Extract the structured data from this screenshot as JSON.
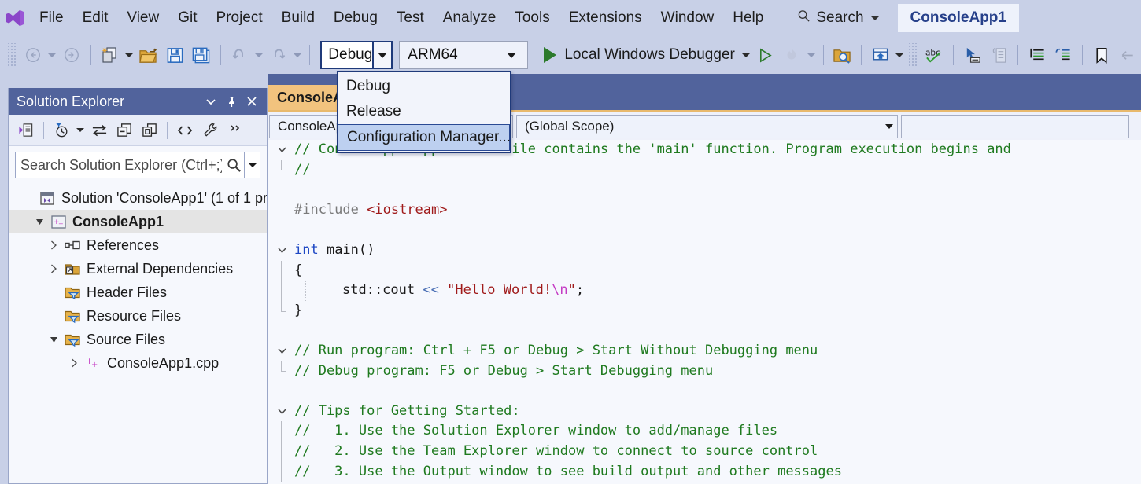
{
  "menubar": {
    "logo_icon": "visual-studio-logo",
    "items": [
      "File",
      "Edit",
      "View",
      "Git",
      "Project",
      "Build",
      "Debug",
      "Test",
      "Analyze",
      "Tools",
      "Extensions",
      "Window",
      "Help"
    ],
    "search": {
      "label": "Search",
      "icon": "search-icon",
      "caret_icon": "chevron-down-icon"
    },
    "project_chip": "ConsoleApp1"
  },
  "toolbar": {
    "nav_back": "back-icon",
    "nav_forward": "forward-icon",
    "new_item": "new-item-icon",
    "open_file": "open-file-icon",
    "save": "save-icon",
    "save_all": "save-all-icon",
    "undo": "undo-icon",
    "redo": "redo-icon",
    "configuration": {
      "value": "Debug",
      "caret_icon": "chevron-down-icon"
    },
    "platform": {
      "value": "ARM64",
      "caret_icon": "chevron-down-icon"
    },
    "run": {
      "label": "Local Windows Debugger",
      "play_icon": "play-icon",
      "caret_icon": "chevron-down-icon"
    },
    "start_no_debug_icon": "play-outline-icon",
    "hot_reload_icon": "hot-reload-flame-icon",
    "right_icons": [
      "folder-search-icon",
      "window-layout-icon",
      "spell-check-abc-icon",
      "select-tool-icon",
      "indent-block-icon",
      "comment-lines-icon",
      "uncomment-lines-icon",
      "bookmark-icon",
      "previous-bookmark-icon"
    ]
  },
  "configuration_menu": {
    "open": true,
    "items": [
      {
        "label": "Debug",
        "selected": false
      },
      {
        "label": "Release",
        "selected": false
      },
      {
        "label": "Configuration Manager...",
        "selected": true
      }
    ]
  },
  "solution_explorer": {
    "title": "Solution Explorer",
    "title_buttons": [
      "chevron-down-icon",
      "pin-icon",
      "close-icon"
    ],
    "toolbar_icons": [
      "home-solution-icon",
      "pending-changes-filter-icon",
      "sync-with-active-document-icon",
      "collapse-all-icon",
      "show-all-files-icon",
      "view-code-icon",
      "properties-wrench-icon",
      "overflow-chevrons-icon"
    ],
    "search_placeholder": "Search Solution Explorer (Ctrl+;)",
    "search_value": "",
    "search_icon": "magnifier-icon",
    "search_dropdown_icon": "chevron-down-icon",
    "tree": [
      {
        "label": "Solution 'ConsoleApp1' (1 of 1 pr",
        "icon": "solution-icon",
        "indent": 0,
        "expander": "none",
        "bold": false,
        "selected": false
      },
      {
        "label": "ConsoleApp1",
        "icon": "cpp-project-icon",
        "indent": 1,
        "expander": "expanded",
        "bold": true,
        "selected": true
      },
      {
        "label": "References",
        "icon": "references-icon",
        "indent": 2,
        "expander": "collapsed",
        "bold": false,
        "selected": false
      },
      {
        "label": "External Dependencies",
        "icon": "external-dependencies-icon",
        "indent": 2,
        "expander": "collapsed",
        "bold": false,
        "selected": false
      },
      {
        "label": "Header Files",
        "icon": "filter-folder-icon",
        "indent": 2,
        "expander": "none",
        "bold": false,
        "selected": false
      },
      {
        "label": "Resource Files",
        "icon": "filter-folder-icon",
        "indent": 2,
        "expander": "none",
        "bold": false,
        "selected": false
      },
      {
        "label": "Source Files",
        "icon": "filter-folder-icon",
        "indent": 2,
        "expander": "expanded",
        "bold": false,
        "selected": false
      },
      {
        "label": "ConsoleApp1.cpp",
        "icon": "cpp-file-icon",
        "indent": 3,
        "expander": "collapsed",
        "bold": false,
        "selected": false
      }
    ]
  },
  "editor": {
    "tab": {
      "label": "ConsoleApp1.cpp",
      "active": true,
      "close_icon": "close-icon"
    },
    "navbar": {
      "project": {
        "value": "ConsoleApp1",
        "caret_icon": "chevron-down-icon"
      },
      "scope": {
        "value": "(Global Scope)",
        "caret_icon": "chevron-down-icon"
      },
      "member": {
        "value": "",
        "caret_icon": "chevron-down-icon"
      }
    },
    "code": [
      {
        "fold": "down",
        "guide": "top",
        "segments": [
          {
            "t": "// ConsoleApp1.cpp : This file contains the 'main' function. Program execution begins and",
            "c": "cm"
          }
        ]
      },
      {
        "fold": "none",
        "guide": "end",
        "segments": [
          {
            "t": "//",
            "c": "cm"
          }
        ]
      },
      {
        "fold": "none",
        "guide": "none",
        "segments": [
          {
            "t": "",
            "c": "txt"
          }
        ]
      },
      {
        "fold": "none",
        "guide": "none",
        "segments": [
          {
            "t": "#include ",
            "c": "pre"
          },
          {
            "t": "<iostream>",
            "c": "str"
          }
        ]
      },
      {
        "fold": "none",
        "guide": "none",
        "segments": [
          {
            "t": "",
            "c": "txt"
          }
        ]
      },
      {
        "fold": "down",
        "guide": "top",
        "segments": [
          {
            "t": "int",
            "c": "kw"
          },
          {
            "t": " main()",
            "c": "txt"
          }
        ]
      },
      {
        "fold": "none",
        "guide": "mid",
        "segments": [
          {
            "t": "{",
            "c": "txt"
          }
        ]
      },
      {
        "fold": "none",
        "guide": "mid",
        "indent": true,
        "segments": [
          {
            "t": "    std::cout ",
            "c": "txt"
          },
          {
            "t": "<<",
            "c": "op"
          },
          {
            "t": " ",
            "c": "txt"
          },
          {
            "t": "\"Hello World!",
            "c": "str"
          },
          {
            "t": "\\n",
            "c": "esc"
          },
          {
            "t": "\"",
            "c": "str"
          },
          {
            "t": ";",
            "c": "txt"
          }
        ]
      },
      {
        "fold": "none",
        "guide": "end",
        "segments": [
          {
            "t": "}",
            "c": "txt"
          }
        ]
      },
      {
        "fold": "none",
        "guide": "none",
        "segments": [
          {
            "t": "",
            "c": "txt"
          }
        ]
      },
      {
        "fold": "down",
        "guide": "top",
        "segments": [
          {
            "t": "// Run program: Ctrl + F5 or Debug > Start Without Debugging menu",
            "c": "cm"
          }
        ]
      },
      {
        "fold": "none",
        "guide": "end",
        "segments": [
          {
            "t": "// Debug program: F5 or Debug > Start Debugging menu",
            "c": "cm"
          }
        ]
      },
      {
        "fold": "none",
        "guide": "none",
        "segments": [
          {
            "t": "",
            "c": "txt"
          }
        ]
      },
      {
        "fold": "down",
        "guide": "top",
        "segments": [
          {
            "t": "// Tips for Getting Started: ",
            "c": "cm"
          }
        ]
      },
      {
        "fold": "none",
        "guide": "mid",
        "segments": [
          {
            "t": "//   1. Use the Solution Explorer window to add/manage files",
            "c": "cm"
          }
        ]
      },
      {
        "fold": "none",
        "guide": "mid",
        "segments": [
          {
            "t": "//   2. Use the Team Explorer window to connect to source control",
            "c": "cm"
          }
        ]
      },
      {
        "fold": "none",
        "guide": "mid",
        "segments": [
          {
            "t": "//   3. Use the Output window to see build output and other messages",
            "c": "cm"
          }
        ]
      }
    ]
  },
  "colors": {
    "chrome": "#c8d0e7",
    "panel_title": "#51639c",
    "editor_bg": "#f6f8fd",
    "tab_active": "#f2c37e",
    "accent_blue": "#1f3a7a",
    "menu_highlight": "#bdd0f0",
    "comment_green": "#1f7a1f",
    "string_red": "#a01b1b",
    "keyword_blue": "#1d47c4",
    "escape_magenta": "#c43bc4",
    "play_green": "#2c7a2c",
    "project_chip_text": "#26408a"
  }
}
